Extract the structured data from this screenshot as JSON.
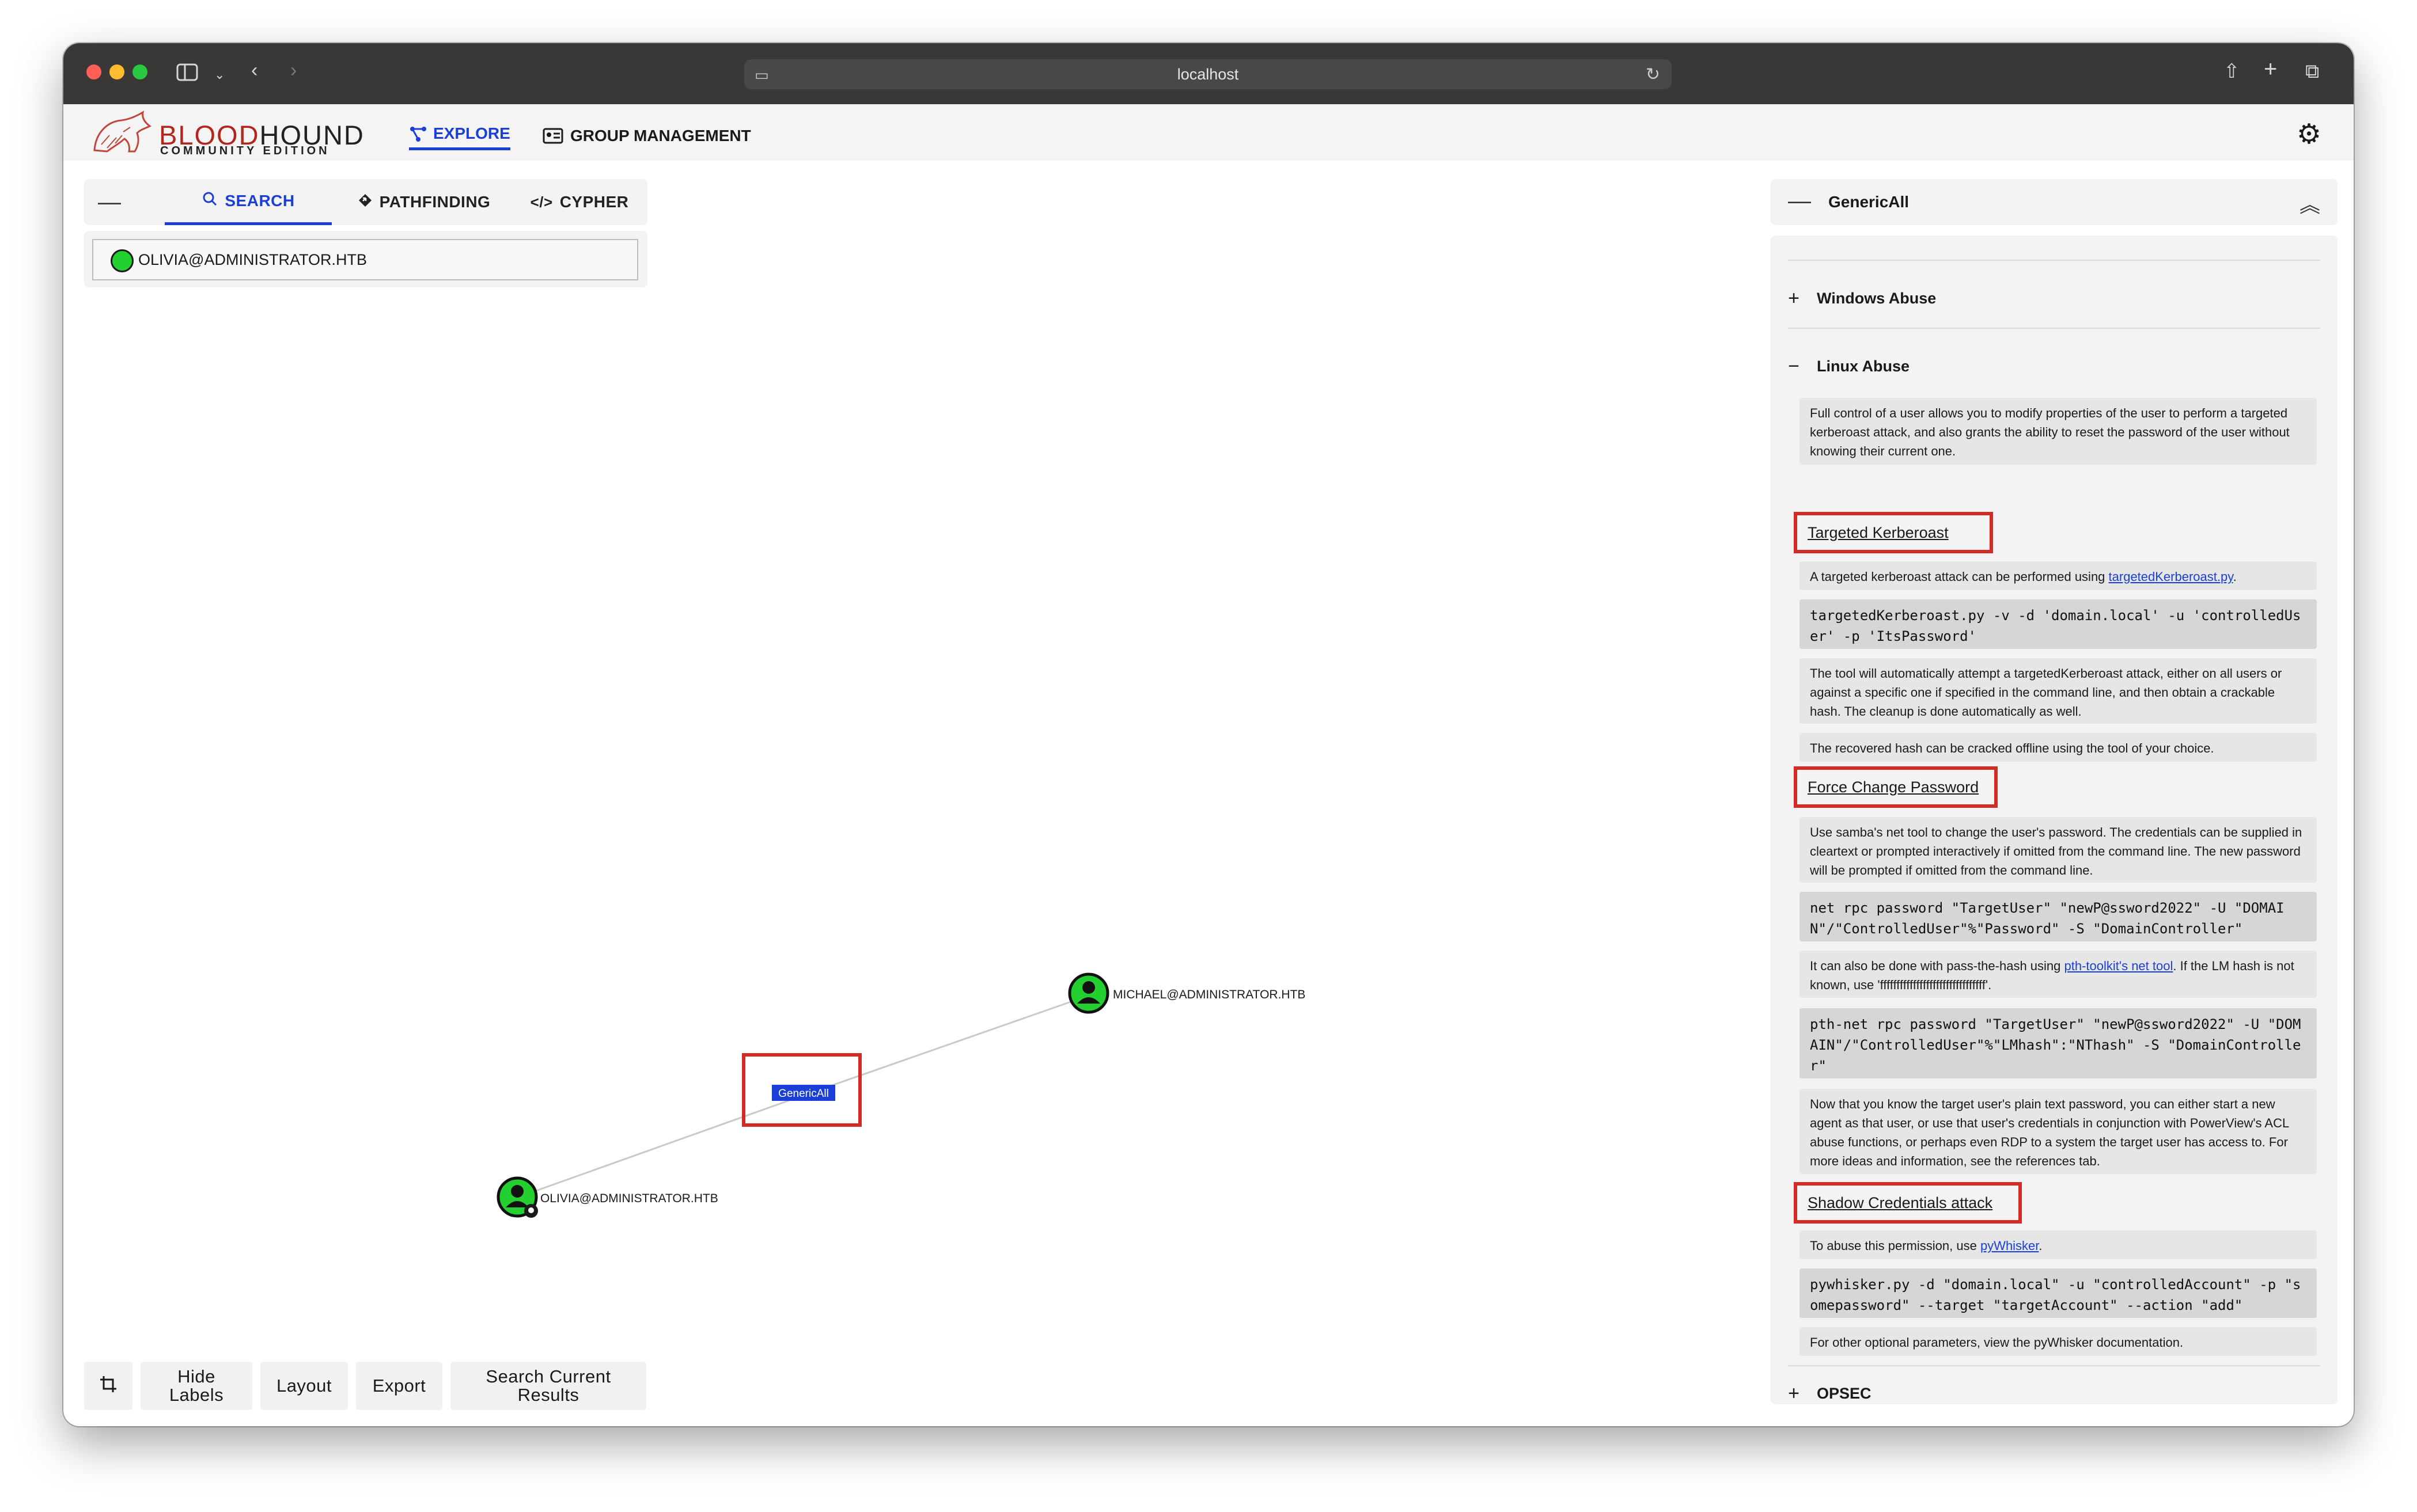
{
  "browser": {
    "url": "localhost"
  },
  "app": {
    "logo_name_a": "BLOOD",
    "logo_name_b": "HOUND",
    "logo_sub": "COMMUNITY EDITION",
    "nav": {
      "explore": "EXPLORE",
      "group_management": "GROUP MANAGEMENT"
    }
  },
  "search_panel": {
    "tabs": [
      "SEARCH",
      "PATHFINDING",
      "CYPHER"
    ],
    "search_value": "OLIVIA@ADMINISTRATOR.HTB"
  },
  "graph": {
    "nodes": [
      {
        "label": "MICHAEL@ADMINISTRATOR.HTB"
      },
      {
        "label": "OLIVIA@ADMINISTRATOR.HTB"
      }
    ],
    "edge_label": "GenericAll"
  },
  "toolbar": {
    "hide_labels_1": "Hide",
    "hide_labels_2": "Labels",
    "layout": "Layout",
    "export": "Export",
    "search_results_1": "Search Current",
    "search_results_2": "Results"
  },
  "details": {
    "title": "GenericAll",
    "windows_abuse": "Windows Abuse",
    "linux_abuse": "Linux Abuse",
    "opsec": "OPSEC",
    "intro": "Full control of a user allows you to modify properties of the user to perform a targeted kerberoast attack, and also grants the ability to reset the password of the user without knowing their current one.",
    "kerberoast": {
      "heading": "Targeted Kerberoast",
      "text_a": "A targeted kerberoast attack can be performed using ",
      "link": "targetedKerberoast.py",
      "text_b": ".",
      "code": "targetedKerberoast.py -v -d 'domain.local' -u 'controlledUser' -p 'ItsPassword'",
      "note": "The tool will automatically attempt a targetedKerberoast attack, either on all users or against a specific one if specified in the command line, and then obtain a crackable hash. The cleanup is done automatically as well.",
      "note2": "The recovered hash can be cracked offline using the tool of your choice."
    },
    "force_change": {
      "heading": "Force Change Password",
      "text": "Use samba's net tool to change the user's password. The credentials can be supplied in cleartext or prompted interactively if omitted from the command line. The new password will be prompted if omitted from the command line.",
      "code": "net rpc password \"TargetUser\" \"newP@ssword2022\" -U \"DOMAIN\"/\"ControlledUser\"%\"Password\" -S \"DomainController\"",
      "pth_a": "It can also be done with pass-the-hash using ",
      "pth_link": "pth-toolkit's net tool",
      "pth_b": ". If the LM hash is not known, use 'ffffffffffffffffffffffffffffffff'.",
      "code2": "pth-net rpc password \"TargetUser\" \"newP@ssword2022\" -U \"DOMAIN\"/\"ControlledUser\"%\"LMhash\":\"NThash\" -S \"DomainController\"",
      "followup": "Now that you know the target user's plain text password, you can either start a new agent as that user, or use that user's credentials in conjunction with PowerView's ACL abuse functions, or perhaps even RDP to a system the target user has access to. For more ideas and information, see the references tab."
    },
    "shadow": {
      "heading": "Shadow Credentials attack",
      "text_a": "To abuse this permission, use ",
      "link": "pyWhisker",
      "text_b": ".",
      "code": "pywhisker.py -d \"domain.local\" -u \"controlledAccount\" -p \"somepassword\" --target \"targetAccount\" --action \"add\"",
      "note": "For other optional parameters, view the pyWhisker documentation."
    }
  }
}
